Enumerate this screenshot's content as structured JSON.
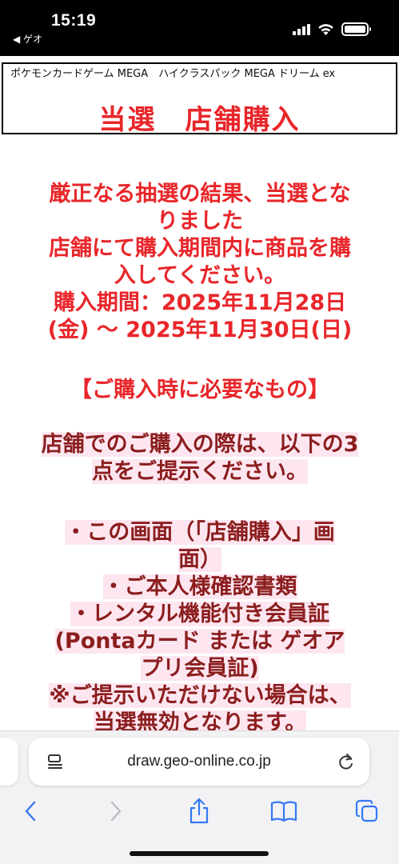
{
  "status_bar": {
    "time": "15:19",
    "back_app": "◀ ゲオ",
    "icons": [
      "cellular-signal-icon",
      "wifi-icon",
      "battery-icon"
    ]
  },
  "header": {
    "product_name": "ポケモンカードゲーム MEGA　ハイクラスパック MEGA ドリーム ex",
    "title": "当選　店舗購入"
  },
  "content": {
    "result_lines": [
      "厳正なる抽選の結果、当選とな",
      "りました",
      "店舗にて購入期間内に商品を購",
      "入してください。",
      "購入期間：2025年11月28日",
      "(金) ～ 2025年11月30日(日)"
    ],
    "required_heading": "【ご購入時に必要なもの】",
    "intro_lines": [
      "店舗でのご購入の際は、以下の3",
      "点をご提示ください。"
    ],
    "list_lines": [
      "・この画面（「店舗購入」画",
      "面）",
      "・ご本人様確認書類",
      "・レンタル機能付き会員証",
      "(Pontaカード または ゲオア",
      "プリ会員証)",
      "※ご提示いただけない場合は、",
      "当選無効となります。"
    ]
  },
  "browser": {
    "url": "draw.geo-online.co.jp",
    "toolbar_icons": [
      "back-icon",
      "forward-icon",
      "share-icon",
      "bookmarks-icon",
      "tabs-icon"
    ]
  },
  "colors": {
    "accent_red": "#e8262a",
    "brown_text": "#8b1e1e",
    "highlight_pink": "#fde6f0"
  }
}
